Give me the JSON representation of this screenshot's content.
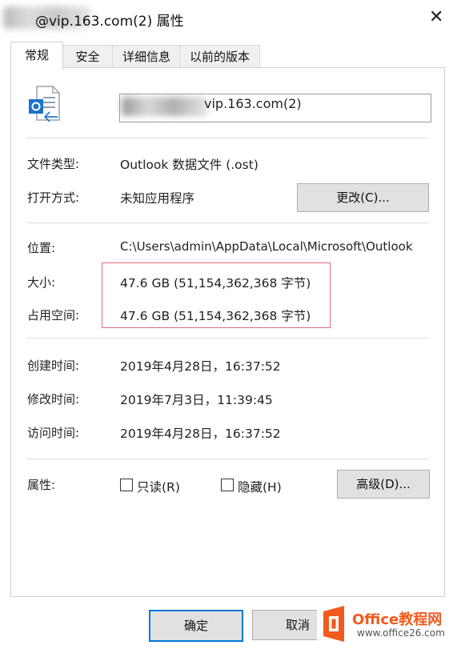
{
  "window": {
    "title": "@vip.163.com(2) 属性",
    "close_glyph": "✕"
  },
  "tabs": [
    {
      "label": "常规",
      "active": true
    },
    {
      "label": "安全"
    },
    {
      "label": "详细信息"
    },
    {
      "label": "以前的版本"
    }
  ],
  "general": {
    "file_name_visible": "vip.163.com(2)",
    "file_type_label": "文件类型:",
    "file_type_value": "Outlook 数据文件 (.ost)",
    "opens_with_label": "打开方式:",
    "opens_with_value": "未知应用程序",
    "change_button": "更改(C)...",
    "location_label": "位置:",
    "location_value": "C:\\Users\\admin\\AppData\\Local\\Microsoft\\Outlook",
    "size_label": "大小:",
    "size_value": "47.6 GB (51,154,362,368 字节)",
    "size_on_disk_label": "占用空间:",
    "size_on_disk_value": "47.6 GB (51,154,362,368 字节)",
    "created_label": "创建时间:",
    "created_value": "2019年4月28日，16:37:52",
    "modified_label": "修改时间:",
    "modified_value": "2019年7月3日，11:39:45",
    "accessed_label": "访问时间:",
    "accessed_value": "2019年4月28日，16:37:52",
    "attributes_label": "属性:",
    "readonly_label": "只读(R)",
    "hidden_label": "隐藏(H)",
    "advanced_button": "高级(D)..."
  },
  "footer": {
    "ok_button": "确定",
    "cancel_button": "取消"
  },
  "watermark": {
    "brand": "Office教程网",
    "url": "www.office26.com"
  },
  "colors": {
    "accent": "#0078d7",
    "highlight_border": "#e06b7a",
    "watermark_orange": "#f25a1d"
  }
}
